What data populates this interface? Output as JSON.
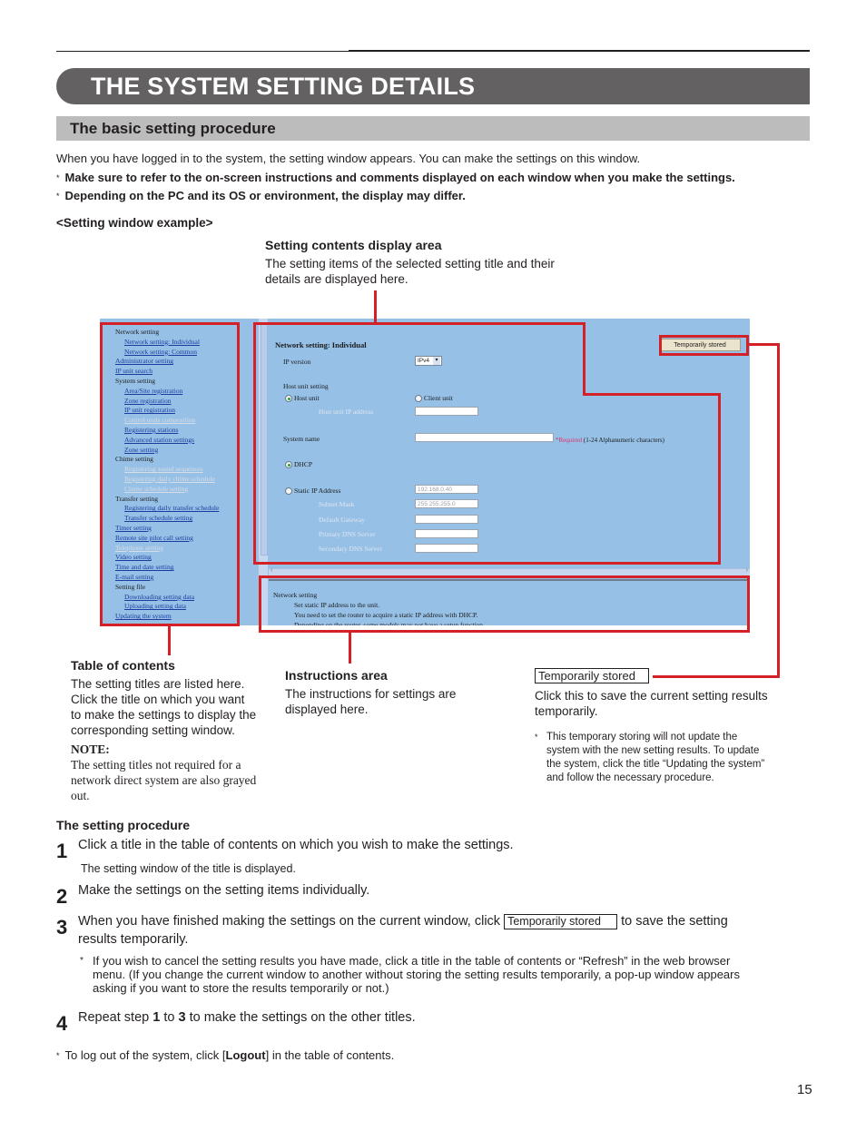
{
  "header": {
    "title": "THE SYSTEM SETTING DETAILS",
    "subtitle": "The basic setting procedure"
  },
  "intro": {
    "text": "When you have logged in to the system, the setting window appears. You can make the settings on this window.",
    "bullets": [
      "Make sure to refer to the on-screen instructions and comments displayed on each window when you make the settings.",
      "Depending on the PC and its OS or environment, the display may differ."
    ],
    "bullet_mark": "*"
  },
  "example_label": "<Setting window example>",
  "callouts": {
    "contents_area": {
      "title": "Setting contents display area",
      "body_lines": [
        "The setting items of the selected setting title and their",
        "details are displayed here."
      ]
    },
    "toc": {
      "title": "Table of contents",
      "body_lines": [
        "The setting titles are listed here.",
        "Click the title on which you want",
        "to make the settings to display the",
        "corresponding setting window."
      ],
      "note_label": "NOTE:",
      "note_lines": [
        "The setting titles not required for a",
        "network direct system are also grayed",
        "out."
      ]
    },
    "instructions": {
      "title": "Instructions area",
      "body_lines": [
        "The instructions for settings are",
        "displayed here."
      ]
    },
    "temp_stored": {
      "button_label": "Temporarily stored",
      "body_lines": [
        "Click this to save the current setting results",
        "temporarily."
      ],
      "note_lines": [
        "This temporary storing will not update the",
        "system with the new setting results. To update",
        "the system, click the title “Updating the system”",
        "and follow the necessary procedure."
      ]
    }
  },
  "screenshot": {
    "toc_items": [
      {
        "label": "Network setting",
        "type": "head",
        "indent": 0
      },
      {
        "label": "Network setting: Individual",
        "type": "link",
        "indent": 1
      },
      {
        "label": "Network setting: Common",
        "type": "link",
        "indent": 1
      },
      {
        "label": "Administrator setting",
        "type": "link",
        "indent": 0
      },
      {
        "label": "IP unit search",
        "type": "link",
        "indent": 0
      },
      {
        "label": "System setting",
        "type": "head",
        "indent": 0
      },
      {
        "label": "Area/Site registration",
        "type": "link",
        "indent": 1
      },
      {
        "label": "Zone registration",
        "type": "link",
        "indent": 1
      },
      {
        "label": "IP unit registration",
        "type": "link",
        "indent": 1
      },
      {
        "label": "Control units composition",
        "type": "gray",
        "indent": 1
      },
      {
        "label": "Registering stations",
        "type": "link",
        "indent": 1
      },
      {
        "label": "Advanced station settings",
        "type": "link",
        "indent": 1
      },
      {
        "label": "Zone setting",
        "type": "link",
        "indent": 1
      },
      {
        "label": "Chime setting",
        "type": "head",
        "indent": 0
      },
      {
        "label": "Registering sound sequences",
        "type": "gray",
        "indent": 1
      },
      {
        "label": "Registering daily chime schedule",
        "type": "gray",
        "indent": 1
      },
      {
        "label": "Chime schedule setting",
        "type": "gray",
        "indent": 1
      },
      {
        "label": "Transfer setting",
        "type": "head",
        "indent": 0
      },
      {
        "label": "Registering daily transfer schedule",
        "type": "link",
        "indent": 1
      },
      {
        "label": "Transfer schedule setting",
        "type": "link",
        "indent": 1
      },
      {
        "label": "Timer setting",
        "type": "link",
        "indent": 0
      },
      {
        "label": "Remote site pilot call setting",
        "type": "link",
        "indent": 0
      },
      {
        "label": "Telephone setting",
        "type": "gray",
        "indent": 0
      },
      {
        "label": "Video setting",
        "type": "link",
        "indent": 0
      },
      {
        "label": "Time and date setting",
        "type": "link",
        "indent": 0
      },
      {
        "label": "E-mail setting",
        "type": "link",
        "indent": 0
      },
      {
        "label": "Setting file",
        "type": "head",
        "indent": 0
      },
      {
        "label": "Downloading setting data",
        "type": "link",
        "indent": 1
      },
      {
        "label": "Uploading setting data",
        "type": "link",
        "indent": 1
      },
      {
        "label": "Updating the system",
        "type": "link",
        "indent": 0
      }
    ],
    "content": {
      "heading": "Network setting: Individual",
      "temp_button": "Temporarily stored",
      "ip_version_label": "IP version",
      "ip_version_value": "IPv4",
      "host_unit_setting_label": "Host unit setting",
      "host_unit_radio": "Host unit",
      "client_unit_radio": "Client unit",
      "host_unit_ip_label": "Host unit IP address",
      "system_name_label": "System name",
      "required_mark": "*Required",
      "required_hint": " (1-24 Alphanumeric characters)",
      "dhcp_radio": "DHCP",
      "static_ip_radio": "Static IP Address",
      "static_ip_value": "192.168.0.40",
      "subnet_label": "Subnet Mask",
      "subnet_value": "255.255.255.0",
      "gateway_label": "Default Gateway",
      "primary_dns_label": "Primary DNS Server",
      "secondary_dns_label": "Secondary DNS Server"
    },
    "instructions": {
      "heading": "Network setting",
      "lines": [
        "Set static IP address to the unit.",
        "You need to set the router to acquire a static IP address with DHCP.",
        "Depending on the router, some models may not have a setup function."
      ]
    }
  },
  "procedure": {
    "title": "The setting procedure",
    "steps": [
      {
        "num": "1",
        "text": "Click a title in the table of contents on which you wish to make the settings.",
        "sub": "The setting window of the title is displayed."
      },
      {
        "num": "2",
        "text": "Make the settings on the setting items individually."
      },
      {
        "num": "3",
        "text_before": "When you have finished making the settings on the current window, click",
        "button": "Temporarily stored",
        "text_after": "to save the setting",
        "text_line2": "results temporarily.",
        "note_lines": [
          "If you wish to cancel the setting results you have made, click a title in the table of contents or “Refresh” in the web browser",
          "menu. (If you change the current window to another without storing the setting results temporarily, a pop-up window appears",
          "asking if you want to store the results temporarily or not.)"
        ]
      },
      {
        "num": "4",
        "text_a": "Repeat step ",
        "bold_a": "1",
        "text_b": " to ",
        "bold_b": "3",
        "text_c": " to make the settings on the other titles."
      }
    ],
    "footnote_a": "To log out of the system, click [",
    "footnote_bold": "Logout",
    "footnote_b": "] in the table of contents."
  },
  "page_number": "15"
}
